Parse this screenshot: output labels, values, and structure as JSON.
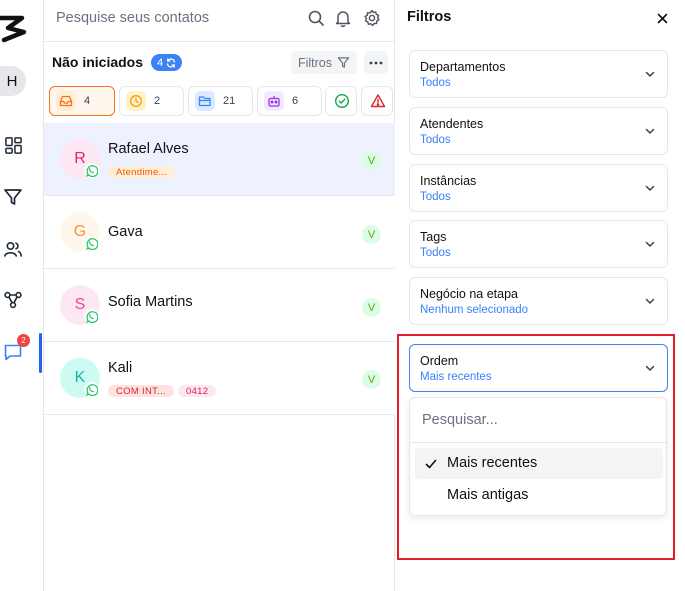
{
  "rail": {
    "avatar_initial": "H",
    "chat_badge": "2"
  },
  "contacts": {
    "search_placeholder": "Pesquise seus contatos",
    "section_title": "Não iniciados",
    "section_count": "4",
    "filters_label": "Filtros",
    "tabs": [
      {
        "icon": "inbox-icon",
        "count": "4"
      },
      {
        "icon": "clock-icon",
        "count": "2"
      },
      {
        "icon": "folder-icon",
        "count": "21"
      },
      {
        "icon": "bot-icon",
        "count": "6"
      },
      {
        "icon": "check-circle-icon",
        "count": ""
      },
      {
        "icon": "warning-icon",
        "count": ""
      }
    ],
    "items": [
      {
        "initial": "R",
        "name": "Rafael Alves",
        "tags": [
          "Atendime..."
        ],
        "status": "V"
      },
      {
        "initial": "G",
        "name": "Gava",
        "tags": [],
        "status": "V"
      },
      {
        "initial": "S",
        "name": "Sofia Martins",
        "tags": [],
        "status": "V"
      },
      {
        "initial": "K",
        "name": "Kali",
        "tags": [
          "COM INT...",
          "0412"
        ],
        "status": "V"
      }
    ]
  },
  "filters": {
    "title": "Filtros",
    "cards": [
      {
        "label": "Departamentos",
        "value": "Todos"
      },
      {
        "label": "Atendentes",
        "value": "Todos"
      },
      {
        "label": "Instâncias",
        "value": "Todos"
      },
      {
        "label": "Tags",
        "value": "Todos"
      },
      {
        "label": "Negócio na etapa",
        "value": "Nenhum selecionado"
      },
      {
        "label": "Ordem",
        "value": "Mais recentes"
      }
    ],
    "dropdown": {
      "search_placeholder": "Pesquisar...",
      "options": [
        {
          "label": "Mais recentes",
          "selected": true
        },
        {
          "label": "Mais antigas",
          "selected": false
        }
      ]
    }
  },
  "colors": {
    "accent": "#3b82f6",
    "highlight": "#e11d2a"
  }
}
